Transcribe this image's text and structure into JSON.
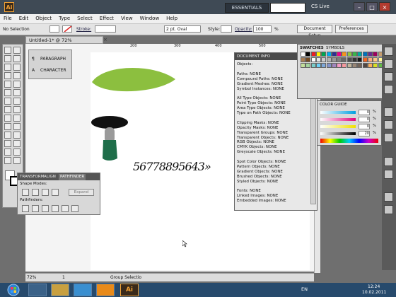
{
  "window": {
    "logo_text": "Ai",
    "workspace": "ESSENTIALS",
    "cs_live": "CS Live"
  },
  "menu": [
    "File",
    "Edit",
    "Object",
    "Type",
    "Select",
    "Effect",
    "View",
    "Window",
    "Help"
  ],
  "control": {
    "selection": "No Selection",
    "stroke_label": "Stroke:",
    "brush": "2 pt. Oval",
    "style_label": "Style:",
    "opacity_label": "Opacity:",
    "opacity_value": "100",
    "opacity_unit": "%",
    "doc_setup": "Document Setup",
    "preferences": "Preferences"
  },
  "document": {
    "tab_title": "Untitled-1* @ 72% (CMYK/Preview)",
    "close": "×"
  },
  "ruler": {
    "marks": [
      "200",
      "300",
      "400",
      "500",
      "600"
    ]
  },
  "status": {
    "zoom": "72%",
    "artboard": "1",
    "tool": "Group Selectio"
  },
  "left_panel": {
    "paragraph": "PARAGRAPH",
    "character": "CHARACTER"
  },
  "pathfinder": {
    "tabs": [
      "TRANSFORM",
      "ALIGN",
      "PATHFINDER"
    ],
    "shape_modes": "Shape Modes:",
    "expand": "Expand",
    "pathfinders": "Pathfinders:"
  },
  "docinfo": {
    "title": "DOCUMENT INFO",
    "lines": [
      "Objects:",
      "",
      "Paths: NONE",
      "Compound Paths: NONE",
      "Gradient Meshes: NONE",
      "Symbol Instances: NONE",
      "",
      "All Type Objects: NONE",
      "Point Type Objects: NONE",
      "Area Type Objects: NONE",
      "Type on Path Objects: NONE",
      "",
      "Clipping Masks: NONE",
      "Opacity Masks: NONE",
      "Transparent Groups: NONE",
      "Transparent Objects: NONE",
      "RGB Objects: NONE",
      "CMYK Objects: NONE",
      "Greyscale Objects: NONE",
      "",
      "Spot Color Objects: NONE",
      "Pattern Objects: NONE",
      "Gradient Objects: NONE",
      "Brushed Objects: NONE",
      "Styled Objects: NONE",
      "",
      "Fonts: NONE",
      "Linked Images: NONE",
      "Embedded Images: NONE"
    ]
  },
  "swatches": {
    "tabs": [
      "SWATCHES",
      "SYMBOLS"
    ]
  },
  "color_guide": {
    "title": "COLOR GUIDE",
    "values": [
      "0",
      "0",
      "0",
      "20"
    ],
    "unit": "%"
  },
  "artwork": {
    "numbers": "56778895643»"
  },
  "taskbar": {
    "lang": "EN",
    "time": "12:24",
    "date": "10.02.2011",
    "app_ai": "Ai"
  },
  "colors": {
    "leaf": "#8cbf3f",
    "cap": "#111111",
    "stem": "#9a9a9a",
    "base": "#1f6e4a",
    "accent": "#f2a134"
  }
}
